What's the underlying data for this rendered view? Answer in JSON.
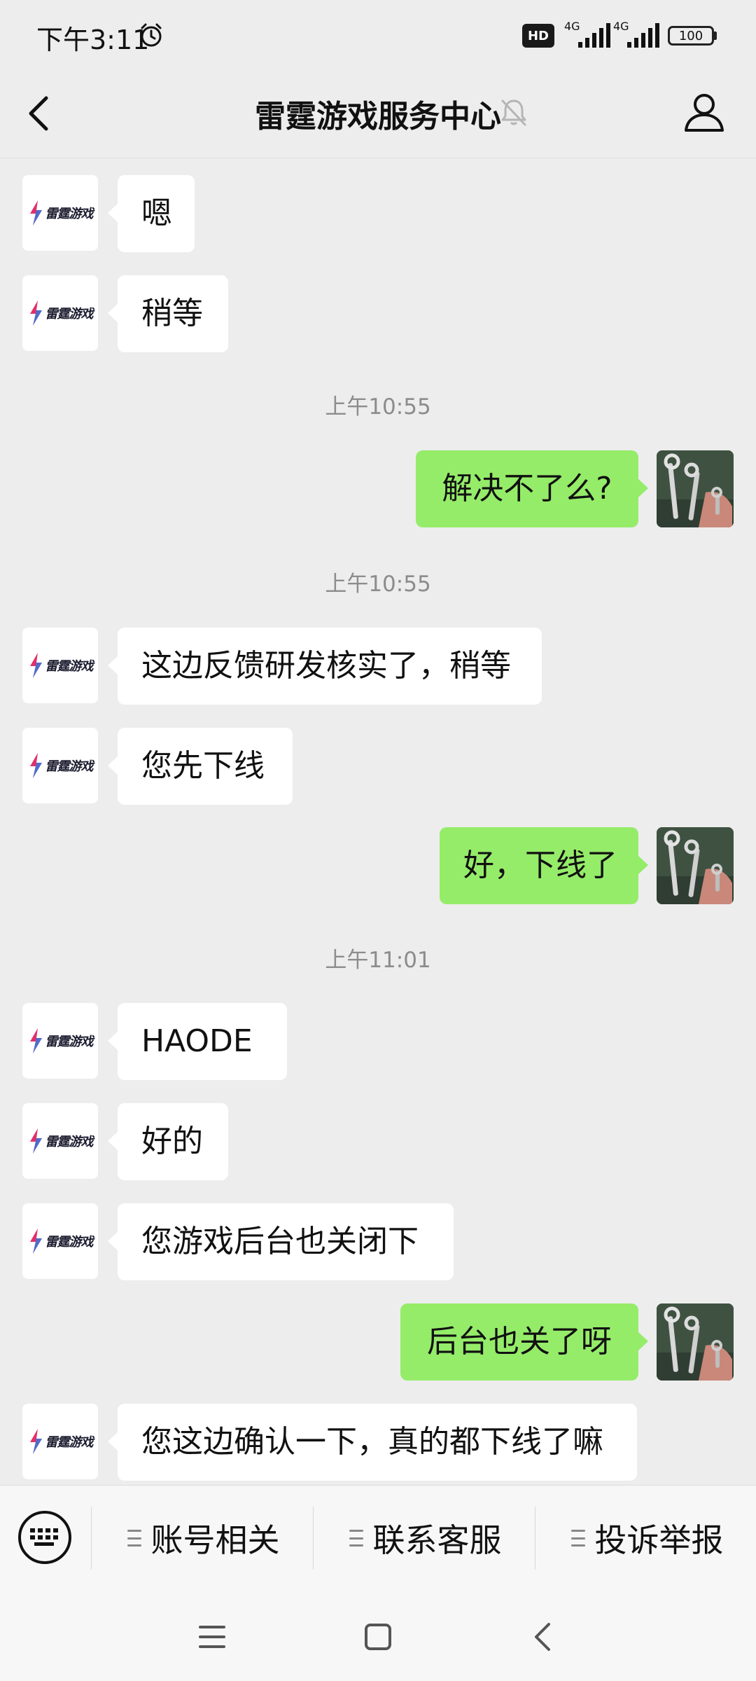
{
  "status": {
    "time": "下午3:11",
    "hd_badge": "HD",
    "network1": "4G",
    "network2": "4G",
    "battery": "100"
  },
  "header": {
    "title": "雷霆游戏服务中心",
    "icons": {
      "back": "chevron-left-icon",
      "mute": "bell-off-icon",
      "profile": "person-icon"
    }
  },
  "brand_avatar": {
    "text": "雷霆游戏",
    "accent": "#e0306a",
    "accent2": "#2b7be4"
  },
  "colors": {
    "outgoing_bubble": "#95ec69",
    "incoming_bubble": "#ffffff",
    "background": "#ededed"
  },
  "messages": [
    {
      "dir": "in",
      "text": "嗯"
    },
    {
      "dir": "in",
      "text": "稍等"
    },
    {
      "timestamp": "上午10:55"
    },
    {
      "dir": "out",
      "text": "解决不了么?"
    },
    {
      "timestamp": "上午10:55"
    },
    {
      "dir": "in",
      "text": "这边反馈研发核实了，稍等"
    },
    {
      "dir": "in",
      "text": "您先下线"
    },
    {
      "dir": "out",
      "text": "好，下线了"
    },
    {
      "timestamp": "上午11:01"
    },
    {
      "dir": "in",
      "text": "HAODE"
    },
    {
      "dir": "in",
      "text": "好的"
    },
    {
      "dir": "in",
      "text": "您游戏后台也关闭下"
    },
    {
      "dir": "out",
      "text": "后台也关了呀"
    },
    {
      "dir": "in",
      "text": "您这边确认一下，真的都下线了嘛"
    }
  ],
  "menu": {
    "keyboard_icon": "keyboard-icon",
    "items": [
      "账号相关",
      "联系客服",
      "投诉举报"
    ]
  },
  "navbar": {
    "icons": [
      "menu-icon",
      "home-square-icon",
      "back-chevron-icon"
    ]
  }
}
